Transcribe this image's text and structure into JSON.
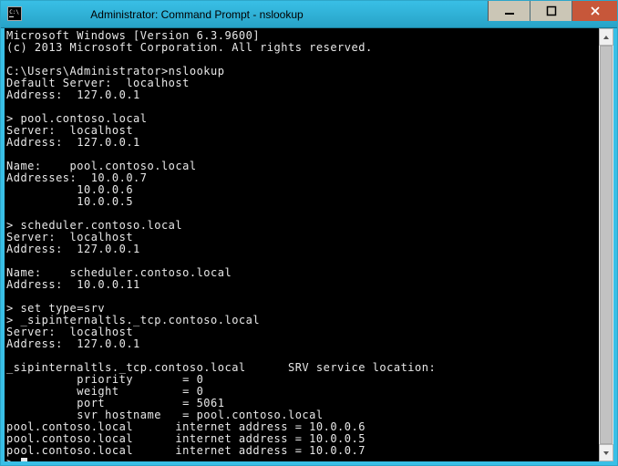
{
  "titlebar": {
    "title": "Administrator: Command Prompt - nslookup"
  },
  "terminal": {
    "lines": [
      "Microsoft Windows [Version 6.3.9600]",
      "(c) 2013 Microsoft Corporation. All rights reserved.",
      "",
      "C:\\Users\\Administrator>nslookup",
      "Default Server:  localhost",
      "Address:  127.0.0.1",
      "",
      "> pool.contoso.local",
      "Server:  localhost",
      "Address:  127.0.0.1",
      "",
      "Name:    pool.contoso.local",
      "Addresses:  10.0.0.7",
      "          10.0.0.6",
      "          10.0.0.5",
      "",
      "> scheduler.contoso.local",
      "Server:  localhost",
      "Address:  127.0.0.1",
      "",
      "Name:    scheduler.contoso.local",
      "Address:  10.0.0.11",
      "",
      "> set type=srv",
      "> _sipinternaltls._tcp.contoso.local",
      "Server:  localhost",
      "Address:  127.0.0.1",
      "",
      "_sipinternaltls._tcp.contoso.local      SRV service location:",
      "          priority       = 0",
      "          weight         = 0",
      "          port           = 5061",
      "          svr hostname   = pool.contoso.local",
      "pool.contoso.local      internet address = 10.0.0.6",
      "pool.contoso.local      internet address = 10.0.0.5",
      "pool.contoso.local      internet address = 10.0.0.7"
    ],
    "prompt": "> "
  }
}
